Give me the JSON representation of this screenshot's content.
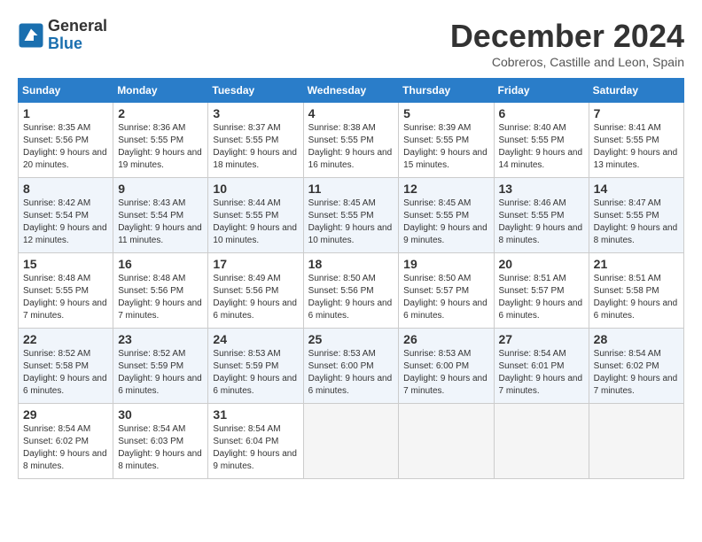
{
  "logo": {
    "line1": "General",
    "line2": "Blue"
  },
  "title": "December 2024",
  "subtitle": "Cobreros, Castille and Leon, Spain",
  "weekdays": [
    "Sunday",
    "Monday",
    "Tuesday",
    "Wednesday",
    "Thursday",
    "Friday",
    "Saturday"
  ],
  "weeks": [
    [
      {
        "day": "1",
        "sunrise": "Sunrise: 8:35 AM",
        "sunset": "Sunset: 5:56 PM",
        "daylight": "Daylight: 9 hours and 20 minutes."
      },
      {
        "day": "2",
        "sunrise": "Sunrise: 8:36 AM",
        "sunset": "Sunset: 5:55 PM",
        "daylight": "Daylight: 9 hours and 19 minutes."
      },
      {
        "day": "3",
        "sunrise": "Sunrise: 8:37 AM",
        "sunset": "Sunset: 5:55 PM",
        "daylight": "Daylight: 9 hours and 18 minutes."
      },
      {
        "day": "4",
        "sunrise": "Sunrise: 8:38 AM",
        "sunset": "Sunset: 5:55 PM",
        "daylight": "Daylight: 9 hours and 16 minutes."
      },
      {
        "day": "5",
        "sunrise": "Sunrise: 8:39 AM",
        "sunset": "Sunset: 5:55 PM",
        "daylight": "Daylight: 9 hours and 15 minutes."
      },
      {
        "day": "6",
        "sunrise": "Sunrise: 8:40 AM",
        "sunset": "Sunset: 5:55 PM",
        "daylight": "Daylight: 9 hours and 14 minutes."
      },
      {
        "day": "7",
        "sunrise": "Sunrise: 8:41 AM",
        "sunset": "Sunset: 5:55 PM",
        "daylight": "Daylight: 9 hours and 13 minutes."
      }
    ],
    [
      {
        "day": "8",
        "sunrise": "Sunrise: 8:42 AM",
        "sunset": "Sunset: 5:54 PM",
        "daylight": "Daylight: 9 hours and 12 minutes."
      },
      {
        "day": "9",
        "sunrise": "Sunrise: 8:43 AM",
        "sunset": "Sunset: 5:54 PM",
        "daylight": "Daylight: 9 hours and 11 minutes."
      },
      {
        "day": "10",
        "sunrise": "Sunrise: 8:44 AM",
        "sunset": "Sunset: 5:55 PM",
        "daylight": "Daylight: 9 hours and 10 minutes."
      },
      {
        "day": "11",
        "sunrise": "Sunrise: 8:45 AM",
        "sunset": "Sunset: 5:55 PM",
        "daylight": "Daylight: 9 hours and 10 minutes."
      },
      {
        "day": "12",
        "sunrise": "Sunrise: 8:45 AM",
        "sunset": "Sunset: 5:55 PM",
        "daylight": "Daylight: 9 hours and 9 minutes."
      },
      {
        "day": "13",
        "sunrise": "Sunrise: 8:46 AM",
        "sunset": "Sunset: 5:55 PM",
        "daylight": "Daylight: 9 hours and 8 minutes."
      },
      {
        "day": "14",
        "sunrise": "Sunrise: 8:47 AM",
        "sunset": "Sunset: 5:55 PM",
        "daylight": "Daylight: 9 hours and 8 minutes."
      }
    ],
    [
      {
        "day": "15",
        "sunrise": "Sunrise: 8:48 AM",
        "sunset": "Sunset: 5:55 PM",
        "daylight": "Daylight: 9 hours and 7 minutes."
      },
      {
        "day": "16",
        "sunrise": "Sunrise: 8:48 AM",
        "sunset": "Sunset: 5:56 PM",
        "daylight": "Daylight: 9 hours and 7 minutes."
      },
      {
        "day": "17",
        "sunrise": "Sunrise: 8:49 AM",
        "sunset": "Sunset: 5:56 PM",
        "daylight": "Daylight: 9 hours and 6 minutes."
      },
      {
        "day": "18",
        "sunrise": "Sunrise: 8:50 AM",
        "sunset": "Sunset: 5:56 PM",
        "daylight": "Daylight: 9 hours and 6 minutes."
      },
      {
        "day": "19",
        "sunrise": "Sunrise: 8:50 AM",
        "sunset": "Sunset: 5:57 PM",
        "daylight": "Daylight: 9 hours and 6 minutes."
      },
      {
        "day": "20",
        "sunrise": "Sunrise: 8:51 AM",
        "sunset": "Sunset: 5:57 PM",
        "daylight": "Daylight: 9 hours and 6 minutes."
      },
      {
        "day": "21",
        "sunrise": "Sunrise: 8:51 AM",
        "sunset": "Sunset: 5:58 PM",
        "daylight": "Daylight: 9 hours and 6 minutes."
      }
    ],
    [
      {
        "day": "22",
        "sunrise": "Sunrise: 8:52 AM",
        "sunset": "Sunset: 5:58 PM",
        "daylight": "Daylight: 9 hours and 6 minutes."
      },
      {
        "day": "23",
        "sunrise": "Sunrise: 8:52 AM",
        "sunset": "Sunset: 5:59 PM",
        "daylight": "Daylight: 9 hours and 6 minutes."
      },
      {
        "day": "24",
        "sunrise": "Sunrise: 8:53 AM",
        "sunset": "Sunset: 5:59 PM",
        "daylight": "Daylight: 9 hours and 6 minutes."
      },
      {
        "day": "25",
        "sunrise": "Sunrise: 8:53 AM",
        "sunset": "Sunset: 6:00 PM",
        "daylight": "Daylight: 9 hours and 6 minutes."
      },
      {
        "day": "26",
        "sunrise": "Sunrise: 8:53 AM",
        "sunset": "Sunset: 6:00 PM",
        "daylight": "Daylight: 9 hours and 7 minutes."
      },
      {
        "day": "27",
        "sunrise": "Sunrise: 8:54 AM",
        "sunset": "Sunset: 6:01 PM",
        "daylight": "Daylight: 9 hours and 7 minutes."
      },
      {
        "day": "28",
        "sunrise": "Sunrise: 8:54 AM",
        "sunset": "Sunset: 6:02 PM",
        "daylight": "Daylight: 9 hours and 7 minutes."
      }
    ],
    [
      {
        "day": "29",
        "sunrise": "Sunrise: 8:54 AM",
        "sunset": "Sunset: 6:02 PM",
        "daylight": "Daylight: 9 hours and 8 minutes."
      },
      {
        "day": "30",
        "sunrise": "Sunrise: 8:54 AM",
        "sunset": "Sunset: 6:03 PM",
        "daylight": "Daylight: 9 hours and 8 minutes."
      },
      {
        "day": "31",
        "sunrise": "Sunrise: 8:54 AM",
        "sunset": "Sunset: 6:04 PM",
        "daylight": "Daylight: 9 hours and 9 minutes."
      },
      null,
      null,
      null,
      null
    ]
  ]
}
